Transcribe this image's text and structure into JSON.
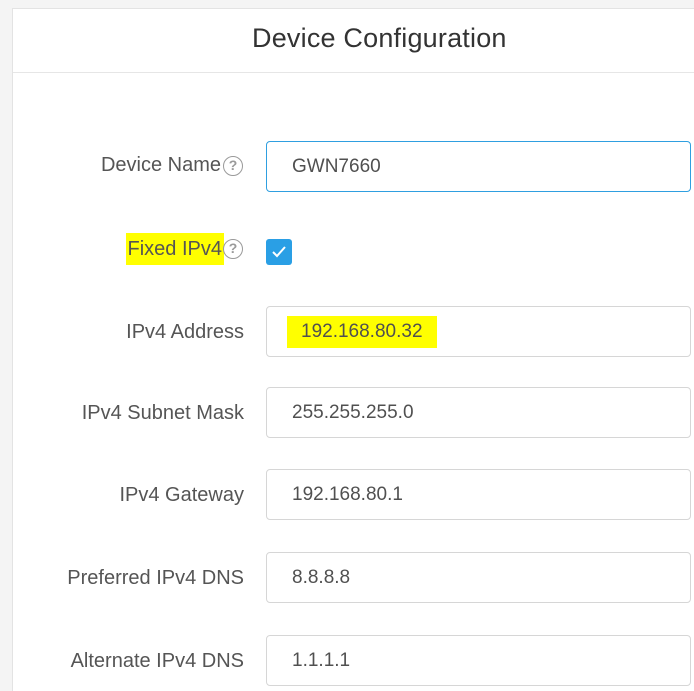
{
  "header": {
    "title": "Device Configuration"
  },
  "form": {
    "device_name": {
      "label": "Device Name",
      "value": "GWN7660"
    },
    "fixed_ipv4": {
      "label": "Fixed IPv4",
      "checked": true
    },
    "ipv4_address": {
      "label": "IPv4 Address",
      "value": "192.168.80.32"
    },
    "ipv4_subnet_mask": {
      "label": "IPv4 Subnet Mask",
      "value": "255.255.255.0"
    },
    "ipv4_gateway": {
      "label": "IPv4 Gateway",
      "value": "192.168.80.1"
    },
    "preferred_ipv4_dns": {
      "label": "Preferred IPv4 DNS",
      "value": "8.8.8.8"
    },
    "alternate_ipv4_dns": {
      "label": "Alternate IPv4 DNS",
      "value": "1.1.1.1"
    }
  },
  "icons": {
    "help": "question-circle-icon",
    "check": "checkmark-icon"
  },
  "help_glyph": "?",
  "colors": {
    "accent": "#2a9fe5",
    "highlight": "#ffff00",
    "label_text": "#555555",
    "input_border": "#d6d6d6"
  }
}
